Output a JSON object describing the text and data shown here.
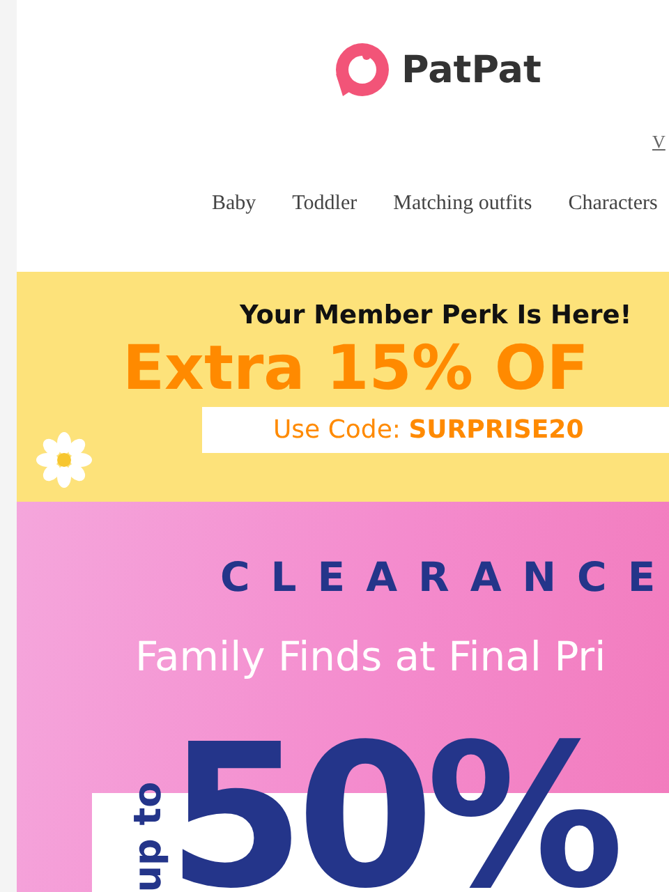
{
  "logo": {
    "text": "PatPat"
  },
  "top_link": {
    "text": "V"
  },
  "nav": [
    {
      "label": "Baby"
    },
    {
      "label": "Toddler"
    },
    {
      "label": "Matching outfits"
    },
    {
      "label": "Characters"
    }
  ],
  "member_banner": {
    "heading": "Your Member Perk Is Here!",
    "offer": "Extra 15% OF",
    "code_text": "Use Code: **SURPRISE20**"
  },
  "clearance_banner": {
    "title": "CLEARANCE",
    "subtitle": "Family Finds at Final Pri",
    "prefix": "up to",
    "amount": "50%"
  }
}
